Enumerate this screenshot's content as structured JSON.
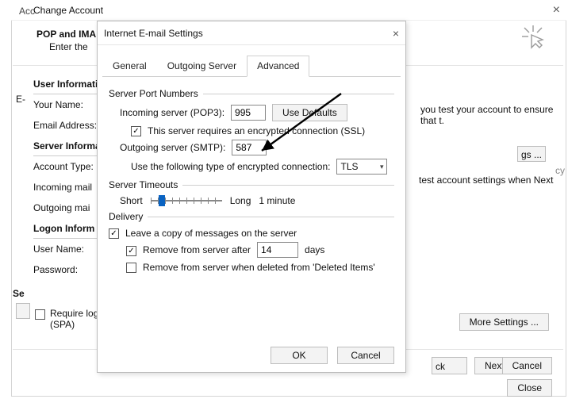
{
  "outer": {
    "account_label": "Acc",
    "title": "Change Account",
    "heading": "POP and IMA",
    "subheading": "Enter the",
    "close": "×"
  },
  "left": {
    "user_info": "User Informati",
    "your_name": "Your Name:",
    "email": "Email Address:",
    "server_info": "Server Informa",
    "account_type": "Account Type:",
    "incoming": "Incoming mail",
    "outgoing": "Outgoing mai",
    "logon_info": "Logon Inform",
    "user_name": "User Name:",
    "password": "Password:",
    "e_label": "E-"
  },
  "back": {
    "test_text": "you test your account to ensure that t.",
    "next_text": "test account settings when Next",
    "gs_label": "gs ...",
    "ck_label": "ck",
    "next_label": "Next >",
    "cancel_label": "Cancel",
    "close_label": "Close",
    "more_settings": "More Settings ...",
    "settings_prefix": "Se",
    "require_spa": "Require log (SPA)",
    "cy": "cy"
  },
  "dialog": {
    "title": "Internet E-mail Settings",
    "close": "×",
    "tabs": {
      "general": "General",
      "outgoing": "Outgoing Server",
      "advanced": "Advanced"
    },
    "server_ports": "Server Port Numbers",
    "incoming_label": "Incoming server (POP3):",
    "incoming_value": "995",
    "use_defaults": "Use Defaults",
    "ssl_label": "This server requires an encrypted connection (SSL)",
    "outgoing_label": "Outgoing server (SMTP):",
    "outgoing_value": "587",
    "enc_label": "Use the following type of encrypted connection:",
    "enc_value": "TLS",
    "server_timeouts": "Server Timeouts",
    "short": "Short",
    "long": "Long",
    "timeout_value": "1 minute",
    "delivery": "Delivery",
    "leave_copy": "Leave a copy of messages on the server",
    "remove_after": "Remove from server after",
    "remove_days_value": "14",
    "days": "days",
    "remove_deleted": "Remove from server when deleted from 'Deleted Items'",
    "ok": "OK",
    "cancel": "Cancel"
  }
}
